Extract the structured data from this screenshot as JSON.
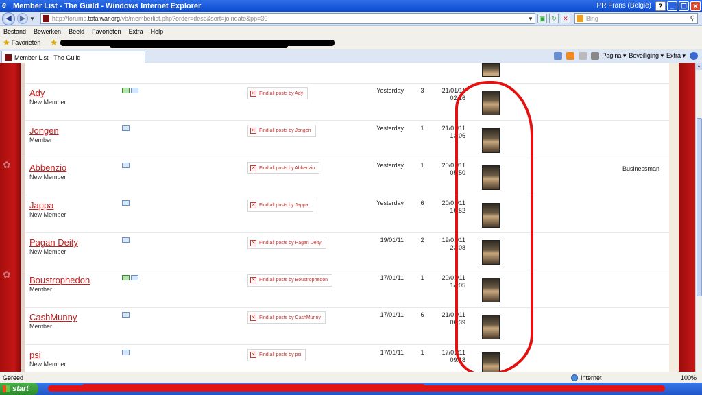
{
  "window": {
    "title": "Member List - The Guild - Windows Internet Explorer",
    "profile": "PR Frans (België)",
    "help_glyph": "?",
    "min_glyph": "_",
    "max_glyph": "❐",
    "close_glyph": "✕"
  },
  "address": {
    "url_prefix": "http://forums.",
    "url_domain": "totalwar.org",
    "url_rest": "/vb/memberlist.php?order=desc&sort=joindate&pp=30",
    "search_placeholder": "Bing"
  },
  "menu": [
    "Bestand",
    "Bewerken",
    "Beeld",
    "Favorieten",
    "Extra",
    "Help"
  ],
  "favorites": {
    "label": "Favorieten"
  },
  "tab": {
    "title": "Member List - The Guild"
  },
  "commands": {
    "page": "Pagina ▾",
    "security": "Beveiliging ▾",
    "extra": "Extra ▾"
  },
  "members": [
    {
      "name": "Ady",
      "rank": "New Member",
      "find": "Find all posts by Ady",
      "last_visit": "Yesterday",
      "posts": "3",
      "join_date": "21/01/11",
      "join_time": "02:16",
      "extra": "",
      "pm": true
    },
    {
      "name": "Jongen",
      "rank": "Member",
      "find": "Find all posts by Jongen",
      "last_visit": "Yesterday",
      "posts": "1",
      "join_date": "21/01/11",
      "join_time": "13:06",
      "extra": "",
      "pm": false
    },
    {
      "name": "Abbenzio",
      "rank": "New Member",
      "find": "Find all posts by Abbenzio",
      "last_visit": "Yesterday",
      "posts": "1",
      "join_date": "20/01/11",
      "join_time": "05:50",
      "extra": "Businessman",
      "pm": false
    },
    {
      "name": "Jappa",
      "rank": "New Member",
      "find": "Find all posts by Jappa",
      "last_visit": "Yesterday",
      "posts": "6",
      "join_date": "20/01/11",
      "join_time": "16:52",
      "extra": "",
      "pm": false
    },
    {
      "name": "Pagan Deity",
      "rank": "New Member",
      "find": "Find all posts by Pagan Deity",
      "last_visit": "19/01/11",
      "posts": "2",
      "join_date": "19/01/11",
      "join_time": "23:08",
      "extra": "",
      "pm": false
    },
    {
      "name": "Boustrophedon",
      "rank": "Member",
      "find": "Find all posts by Boustrophedon",
      "last_visit": "17/01/11",
      "posts": "1",
      "join_date": "20/01/11",
      "join_time": "14:05",
      "extra": "",
      "pm": true
    },
    {
      "name": "CashMunny",
      "rank": "Member",
      "find": "Find all posts by CashMunny",
      "last_visit": "17/01/11",
      "posts": "6",
      "join_date": "21/01/11",
      "join_time": "06:39",
      "extra": "",
      "pm": false
    },
    {
      "name": "psi",
      "rank": "New Member",
      "find": "Find all posts by psi",
      "last_visit": "17/01/11",
      "posts": "1",
      "join_date": "17/01/11",
      "join_time": "09:18",
      "extra": "",
      "pm": false
    }
  ],
  "status": {
    "text": "Gereed",
    "zone": "Internet",
    "zoom": "100%"
  },
  "taskbar": {
    "start": "start"
  },
  "colors": {
    "link": "#c41e1e",
    "annotation": "#e51010",
    "titlebar": "#0a4bd0"
  }
}
